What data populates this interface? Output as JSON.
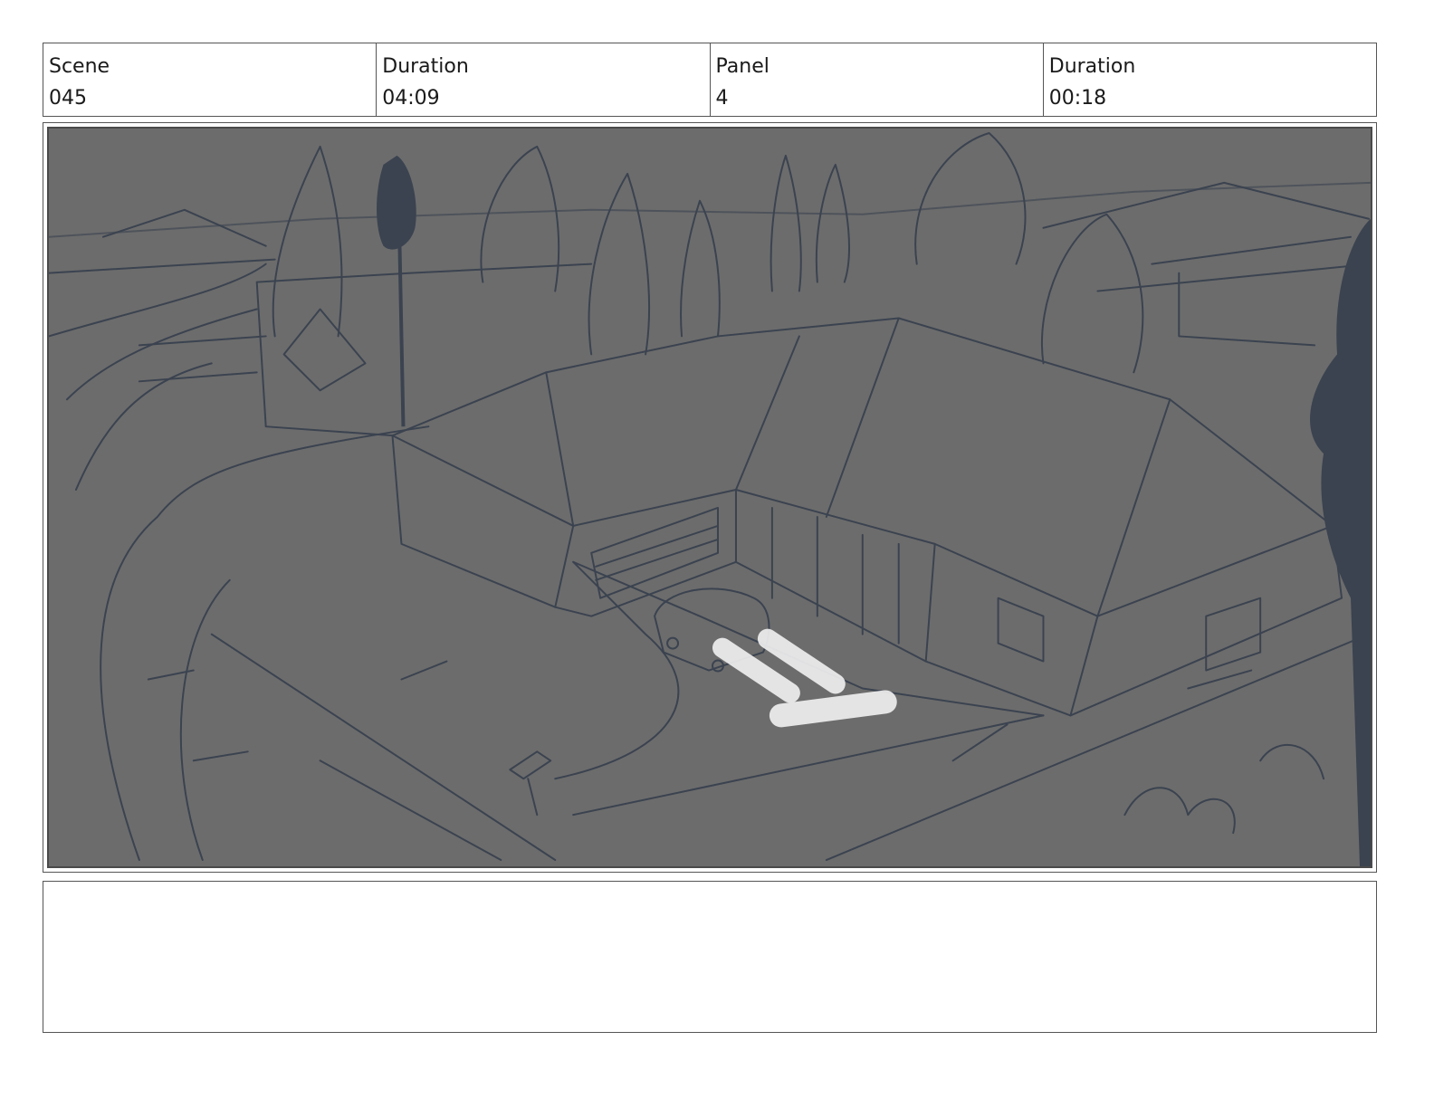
{
  "header": {
    "scene": {
      "label": "Scene",
      "value": "045"
    },
    "scene_duration": {
      "label": "Duration",
      "value": "04:09"
    },
    "panel": {
      "label": "Panel",
      "value": "4"
    },
    "panel_duration": {
      "label": "Duration",
      "value": "00:18"
    }
  },
  "colors": {
    "sketch_background": "#6c6c6c",
    "sketch_line": "#3b4350",
    "highlight": "#f2f2f2"
  },
  "notes": {
    "text": ""
  }
}
